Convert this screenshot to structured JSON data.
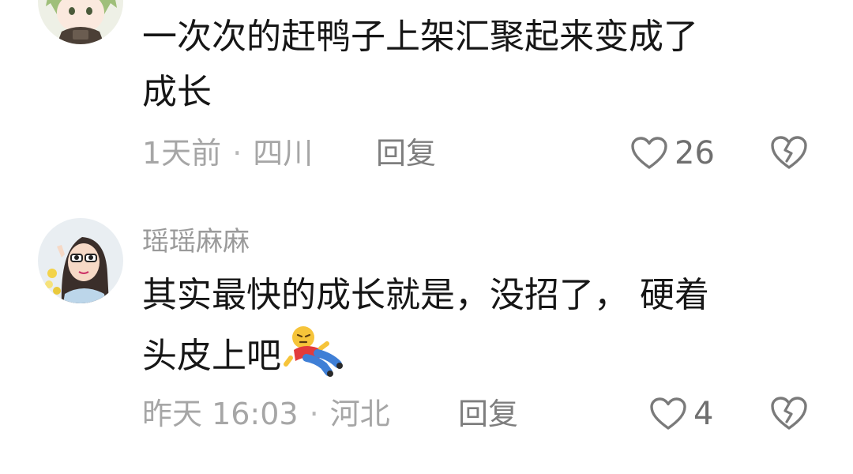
{
  "comments": [
    {
      "avatar": "avatar-anime-green-hair",
      "content_lines": [
        "一次次的赶鸭子上架汇聚起来变成了",
        "成长"
      ],
      "time": "1天前",
      "location": "四川",
      "reply_label": "回复",
      "likes": "26",
      "like_icon": "heart-outline-icon",
      "dislike_icon": "broken-heart-icon"
    },
    {
      "username": "瑶瑶麻麻",
      "avatar": "avatar-girl-sunglasses",
      "content_lines": [
        "其实最快的成长就是，没招了， 硬着",
        "头皮上吧"
      ],
      "emoji": "lying-down-sticker",
      "time": "昨天 16:03",
      "location": "河北",
      "reply_label": "回复",
      "likes": "4",
      "like_icon": "heart-outline-icon",
      "dislike_icon": "broken-heart-icon"
    }
  ],
  "separator": "·",
  "colors": {
    "primary_text": "#161616",
    "meta_text": "#a6a6a6",
    "username": "#9a9a9a",
    "icon_gray": "#7a7a7a"
  }
}
